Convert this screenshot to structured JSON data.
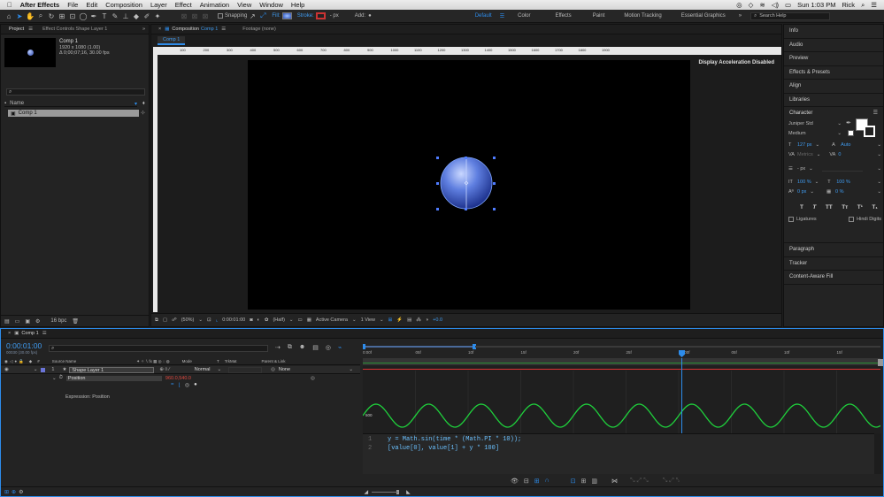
{
  "menubar": {
    "app": "After Effects",
    "items": [
      "File",
      "Edit",
      "Composition",
      "Layer",
      "Effect",
      "Animation",
      "View",
      "Window",
      "Help"
    ],
    "clock": "Sun 1:03 PM",
    "user": "Rick"
  },
  "toolbar": {
    "snapping": "Snapping",
    "fill": "Fill:",
    "stroke": "Stroke:",
    "stroke_px": "- px",
    "add": "Add:",
    "workspaces": [
      "Default",
      "Color",
      "Effects",
      "Paint",
      "Motion Tracking",
      "Essential Graphics"
    ],
    "active_workspace": "Default",
    "search_help": "Search Help"
  },
  "project": {
    "tab_project": "Project",
    "tab_effect_controls": "Effect Controls Shape Layer 1",
    "comp_name": "Comp 1",
    "comp_info_1": "1920 x 1080 (1.00)",
    "comp_info_2": "Δ 0;00;07;16, 30.00 fps",
    "search_placeholder": "",
    "column_name": "Name",
    "item": "Comp 1",
    "bpc": "16 bpc"
  },
  "composition": {
    "tab": "Composition",
    "tab_comp": "Comp 1",
    "tab_footage": "Footage (none)",
    "breadcrumb": "Comp 1",
    "display_notice": "Display Acceleration Disabled",
    "ruler_labels": [
      "100",
      "200",
      "300",
      "400",
      "500",
      "600",
      "700",
      "800",
      "900",
      "1000",
      "1100",
      "1200",
      "1300",
      "1400",
      "1500",
      "1600",
      "1700",
      "1800",
      "1900"
    ],
    "zoom": "(50%)",
    "timecode": "0:00:01:00",
    "resolution": "(Half)",
    "camera": "Active Camera",
    "views": "1 View",
    "exposure": "+0.0"
  },
  "right_panel": {
    "items_top": [
      "Info",
      "Audio",
      "Preview",
      "Effects & Presets",
      "Align",
      "Libraries"
    ],
    "character": {
      "title": "Character",
      "font": "Juniper Std",
      "style": "Medium",
      "size": "127 px",
      "leading": "Auto",
      "kerning": "Metrics",
      "tracking": "0",
      "stroke": "- px",
      "vscale": "100 %",
      "hscale": "100 %",
      "baseline": "0 px",
      "tsume": "0 %",
      "ligatures": "Ligatures",
      "hindi": "Hindi Digits",
      "styles": [
        "T",
        "T",
        "TT",
        "Tт",
        "T¹",
        "T₁"
      ]
    },
    "items_bottom": [
      "Paragraph",
      "Tracker",
      "Content-Aware Fill"
    ]
  },
  "timeline": {
    "tab": "Comp 1",
    "timecode": "0:00:01:00",
    "timecode_sub": "00030 (30.00 fps)",
    "columns": {
      "source": "Source Name",
      "mode": "Mode",
      "t": "T",
      "trkmat": "TrkMat",
      "parent": "Parent & Link"
    },
    "layer": {
      "num": "1",
      "name": "Shape Layer 1",
      "mode": "Normal",
      "parent": "None"
    },
    "property": {
      "name": "Position",
      "value": "960.0,540.0"
    },
    "expression_label": "Expression: Position",
    "ruler": [
      "0:00f",
      "05f",
      "10f",
      "15f",
      "20f",
      "25f",
      "01:00f",
      "05f",
      "10f",
      "15f"
    ],
    "graph_label": "500",
    "code_lines": [
      {
        "n": "1",
        "text": "y = Math.sin(time * (Math.PI * 10));"
      },
      {
        "n": "2",
        "text": "[value[0], value[1] + y * 100]"
      }
    ]
  },
  "colors": {
    "accent": "#2d8ceb",
    "wave": "#1fd13c",
    "value_red": "#e0483f",
    "layer_label": "#6a74d8"
  }
}
